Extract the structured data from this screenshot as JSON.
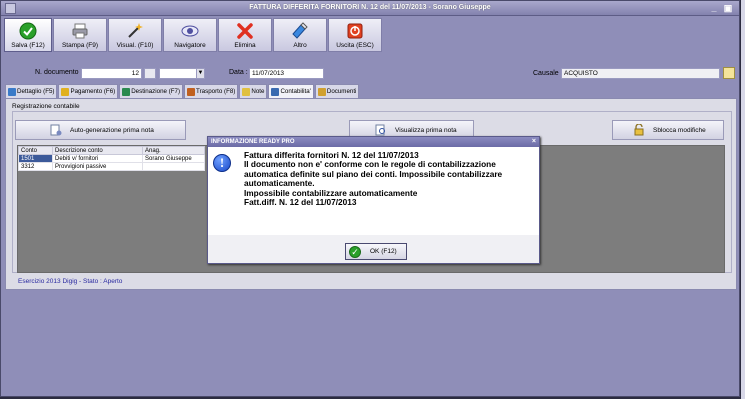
{
  "window": {
    "title": "FATTURA DIFFERITA FORNITORI N. 12 del 11/07/2013 - Sorano Giuseppe",
    "minimize": "_",
    "maximize": "▣"
  },
  "toolbar": {
    "buttons": [
      {
        "label": "Salva (F12)",
        "icon": "check-icon",
        "color": "#2aa02a"
      },
      {
        "label": "Stampa (F9)",
        "icon": "printer-icon",
        "color": "#808090"
      },
      {
        "label": "Visual.  (F10)",
        "icon": "magic-wand-icon",
        "color": "#e8a020"
      },
      {
        "label": "Navigatore",
        "icon": "eye-icon",
        "color": "#6060a0"
      },
      {
        "label": "Elimina",
        "icon": "delete-x-icon",
        "color": "#e03020"
      },
      {
        "label": "Altro",
        "icon": "wand-icon",
        "color": "#3080e0"
      },
      {
        "label": "Uscita (ESC)",
        "icon": "exit-icon",
        "color": "#e04020"
      }
    ]
  },
  "form": {
    "doc_label": "N. documento :",
    "doc_number": "12",
    "data_label": "Data :",
    "data_value": "11/07/2013",
    "causale_label": "Causale :",
    "causale_value": "ACQUISTO"
  },
  "tabs": [
    {
      "label": "Dettaglio (F5)",
      "color": "#3a7ac8"
    },
    {
      "label": "Pagamento (F6)",
      "color": "#e0b020"
    },
    {
      "label": "Destinazione (F7)",
      "color": "#2a8a50"
    },
    {
      "label": "Trasporto (F8)",
      "color": "#c06020"
    },
    {
      "label": "Note",
      "color": "#e0c040"
    },
    {
      "label": "Contabilita'",
      "color": "#3a6ab0"
    },
    {
      "label": "Documenti",
      "color": "#d0a030"
    }
  ],
  "registrazione": {
    "section_label": "Registrazione contabile",
    "btn_autogen": "Auto-generazione prima nota",
    "btn_visualizza": "Visualizza prima nota",
    "btn_sblocca": "Sblocca modifiche"
  },
  "grid": {
    "columns": [
      "Conto",
      "Descrizione conto",
      "Anag."
    ],
    "rows": [
      [
        "1501",
        "Debiti v/ fornitori",
        "Sorano Giuseppe"
      ],
      [
        "3312",
        "Provvigioni passive",
        ""
      ]
    ]
  },
  "status": {
    "text": "Esercizio 2013 Digig - Stato : Aperto"
  },
  "dialog": {
    "title": "INFORMAZIONE READY PRO",
    "close": "×",
    "icon": "info-icon",
    "lines": [
      "Fattura differita fornitori N. 12 del 11/07/2013",
      "Il documento non e' conforme con le regole di contabilizzazione",
      "automatica definite sul piano dei conti. Impossibile contabilizzare",
      "automaticamente.",
      "Impossibile contabilizzare automaticamente",
      "Fatt.diff. N. 12 del 11/07/2013"
    ],
    "ok_label": "OK (F12)"
  }
}
